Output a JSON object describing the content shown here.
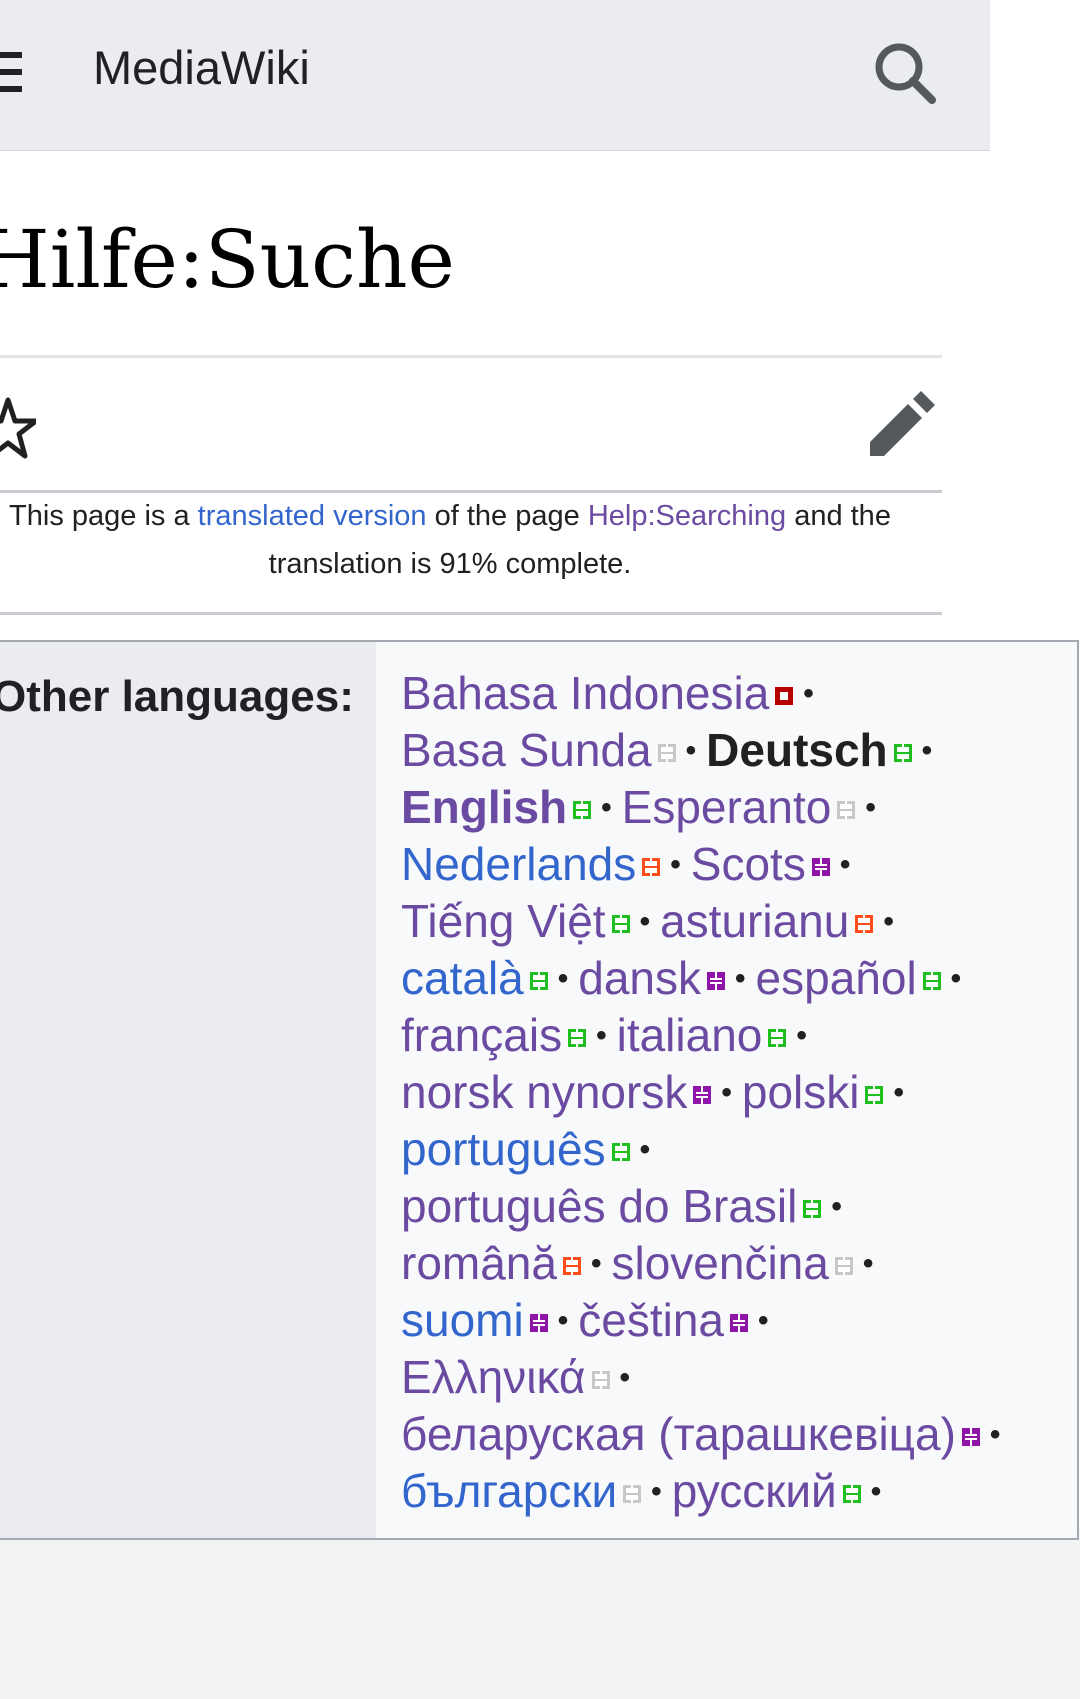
{
  "header": {
    "site_title": "MediaWiki",
    "menu_icon": "hamburger-menu-icon",
    "search_icon": "search-icon"
  },
  "page": {
    "title": "Hilfe:Suche",
    "watch_icon": "star-icon",
    "edit_icon": "pencil-icon"
  },
  "translation_notice": {
    "prefix": "This page is a",
    "translated_link": "translated version",
    "middle": "of the page",
    "source_link": "Help:Searching",
    "suffix_line1": "and the",
    "line2": "translation is 91% complete."
  },
  "other_languages": {
    "label": "Other languages:",
    "separator": "•",
    "lines": [
      [
        {
          "name": "Bahasa Indonesia",
          "color": "#6b4ba1",
          "status": "s20"
        }
      ],
      [
        {
          "name": "Basa Sunda",
          "color": "#6b4ba1",
          "status": "s40"
        },
        {
          "name": "Deutsch",
          "color": "#202122",
          "status": "s100",
          "current": true
        }
      ],
      [
        {
          "name": "English",
          "color": "#6b4ba1",
          "status": "s100",
          "bold": true
        },
        {
          "name": "Esperanto",
          "color": "#6b4ba1",
          "status": "s40"
        }
      ],
      [
        {
          "name": "Nederlands",
          "color": "#3366cc",
          "status": "s80"
        },
        {
          "name": "Scots",
          "color": "#6b4ba1",
          "status": "s60"
        }
      ],
      [
        {
          "name": "Tiếng Việt",
          "color": "#6b4ba1",
          "status": "s100"
        },
        {
          "name": "asturianu",
          "color": "#6b4ba1",
          "status": "s80"
        }
      ],
      [
        {
          "name": "català",
          "color": "#3366cc",
          "status": "s100"
        },
        {
          "name": "dansk",
          "color": "#6b4ba1",
          "status": "s60"
        },
        {
          "name": "español",
          "color": "#6b4ba1",
          "status": "s100"
        }
      ],
      [
        {
          "name": "français",
          "color": "#6b4ba1",
          "status": "s100"
        },
        {
          "name": "italiano",
          "color": "#6b4ba1",
          "status": "s100"
        }
      ],
      [
        {
          "name": "norsk nynorsk",
          "color": "#6b4ba1",
          "status": "s60"
        },
        {
          "name": "polski",
          "color": "#6b4ba1",
          "status": "s100"
        }
      ],
      [
        {
          "name": "português",
          "color": "#3366cc",
          "status": "s100"
        }
      ],
      [
        {
          "name": "português do Brasil",
          "color": "#6b4ba1",
          "status": "s100"
        }
      ],
      [
        {
          "name": "română",
          "color": "#6b4ba1",
          "status": "s80"
        },
        {
          "name": "slovenčina",
          "color": "#6b4ba1",
          "status": "s40"
        }
      ],
      [
        {
          "name": "suomi",
          "color": "#3366cc",
          "status": "s60"
        },
        {
          "name": "čeština",
          "color": "#6b4ba1",
          "status": "s60"
        }
      ],
      [
        {
          "name": "Ελληνικά",
          "color": "#6b4ba1",
          "status": "s40"
        }
      ],
      [
        {
          "name": "беларуская (тарашкевіца)",
          "color": "#6b4ba1",
          "status": "s60"
        }
      ],
      [
        {
          "name": "български",
          "color": "#3366cc",
          "status": "s40"
        },
        {
          "name": "русский",
          "color": "#6b4ba1",
          "status": "s100"
        }
      ]
    ]
  }
}
